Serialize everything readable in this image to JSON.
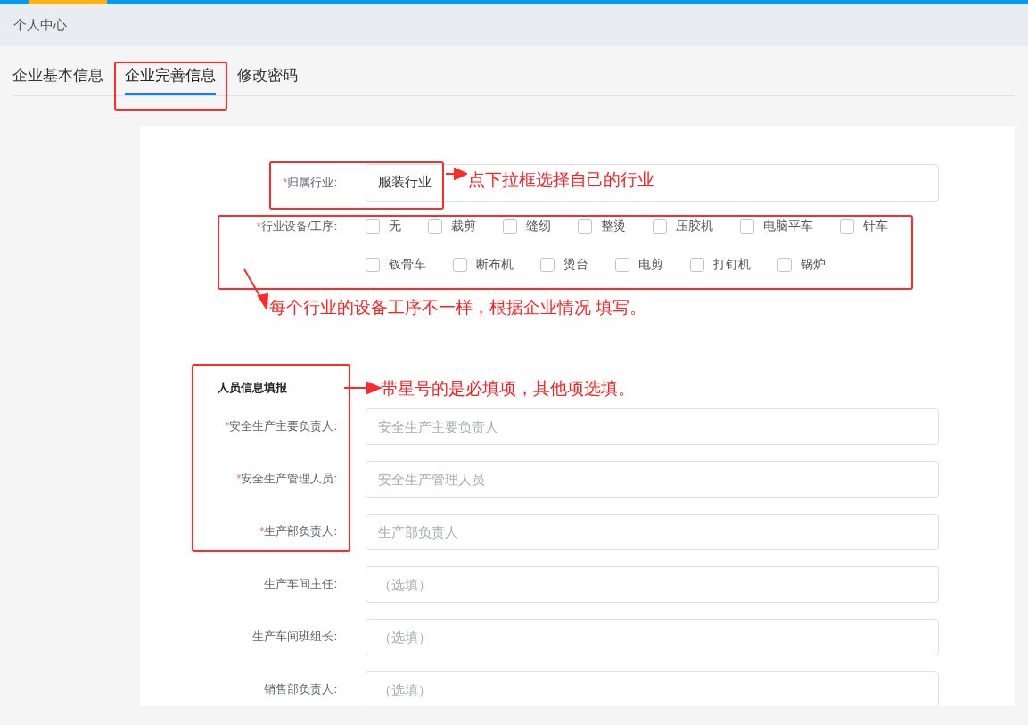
{
  "header": {
    "title": "个人中心"
  },
  "tabs": [
    {
      "label": "企业基本信息",
      "selected": false
    },
    {
      "label": "企业完善信息",
      "selected": true
    },
    {
      "label": "修改密码",
      "selected": false
    }
  ],
  "industry": {
    "required_mark": "*",
    "label": "归属行业:",
    "value": "服装行业"
  },
  "equipment": {
    "required_mark": "*",
    "label": "行业设备/工序:",
    "options": [
      {
        "label": "无",
        "checked": false
      },
      {
        "label": "裁剪",
        "checked": false
      },
      {
        "label": "缝纫",
        "checked": false
      },
      {
        "label": "整烫",
        "checked": false
      },
      {
        "label": "压胶机",
        "checked": false
      },
      {
        "label": "电脑平车",
        "checked": false
      },
      {
        "label": "针车",
        "checked": false
      },
      {
        "label": "钗骨车",
        "checked": false
      },
      {
        "label": "断布机",
        "checked": false
      },
      {
        "label": "烫台",
        "checked": false
      },
      {
        "label": "电剪",
        "checked": false
      },
      {
        "label": "打钉机",
        "checked": false
      },
      {
        "label": "锅炉",
        "checked": false
      }
    ]
  },
  "personnel": {
    "title": "人员信息填报",
    "fields": [
      {
        "required_mark": "*",
        "label": "安全生产主要负责人:",
        "placeholder": "安全生产主要负责人"
      },
      {
        "required_mark": "*",
        "label": "安全生产管理人员:",
        "placeholder": "安全生产管理人员"
      },
      {
        "required_mark": "*",
        "label": "生产部负责人:",
        "placeholder": "生产部负责人"
      },
      {
        "label": "生产车间主任:",
        "placeholder": "（选填）"
      },
      {
        "label": "生产车间班组长:",
        "placeholder": "（选填）"
      },
      {
        "label": "销售部负责人:",
        "placeholder": "（选填）"
      }
    ]
  },
  "annotations": [
    {
      "text": "点下拉框选择自己的行业"
    },
    {
      "text": "每个行业的设备工序不一样，根据企业情况 填写。"
    },
    {
      "text": "带星号的是必填项，其他项选填。"
    }
  ]
}
